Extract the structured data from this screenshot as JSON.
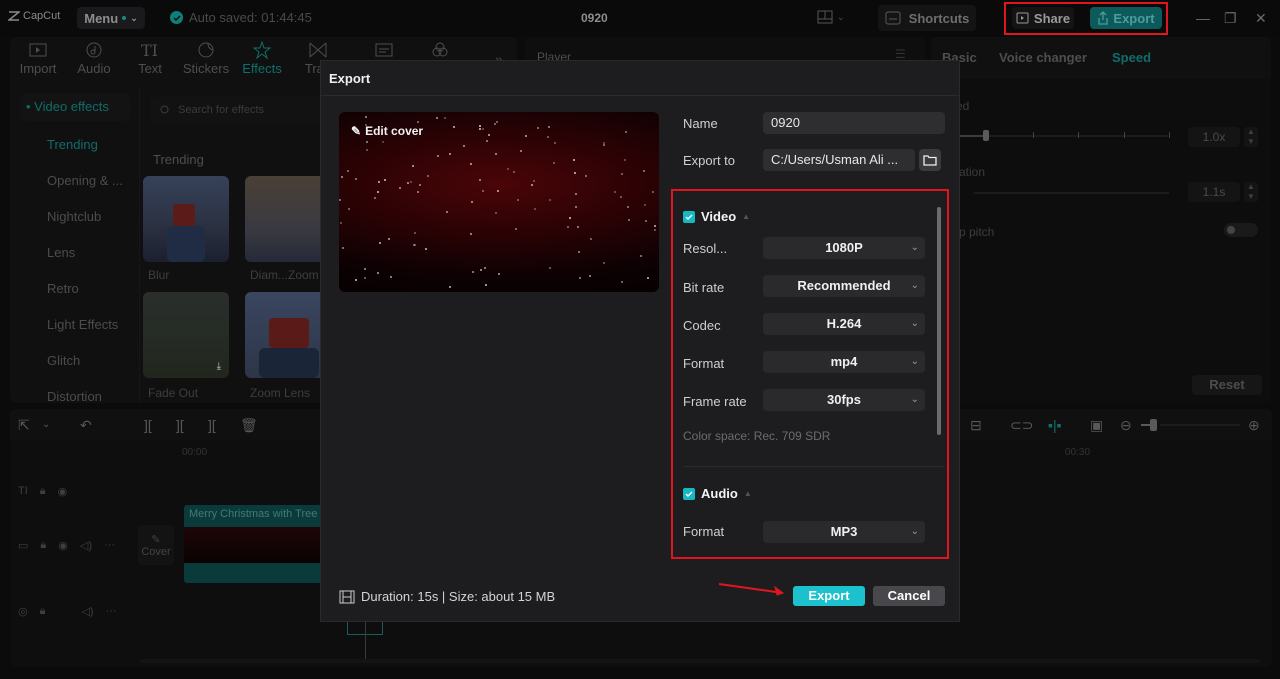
{
  "app": {
    "logo": "CapCut",
    "menu_label": "Menu",
    "autosave": "Auto saved: 01:44:45",
    "project_title": "0920",
    "shortcuts_label": "Shortcuts",
    "share_label": "Share",
    "export_label": "Export"
  },
  "tools": [
    {
      "label": "Import",
      "icon": "import-icon"
    },
    {
      "label": "Audio",
      "icon": "audio-icon"
    },
    {
      "label": "Text",
      "icon": "text-icon"
    },
    {
      "label": "Stickers",
      "icon": "stickers-icon"
    },
    {
      "label": "Effects",
      "icon": "effects-icon",
      "active": true
    },
    {
      "label": "Tran",
      "icon": "transitions-icon"
    }
  ],
  "effects_panel": {
    "section": "Video effects",
    "categories": [
      "Trending",
      "Opening & ...",
      "Nightclub",
      "Lens",
      "Retro",
      "Light Effects",
      "Glitch",
      "Distortion"
    ],
    "active_category": "Trending",
    "search_placeholder": "Search for effects",
    "heading": "Trending",
    "items": [
      "Blur",
      "Diam...Zoom",
      "Fade Out",
      "Zoom Lens"
    ]
  },
  "player": {
    "title": "Player"
  },
  "right_panel": {
    "tabs": [
      "Basic",
      "Voice changer",
      "Speed"
    ],
    "active_tab": "Speed",
    "speed_label": "ed",
    "speed_value": "1.0x",
    "duration_label": "ation",
    "duration_value": "1.1s",
    "pitch_label": "p pitch",
    "reset_label": "Reset"
  },
  "timeline": {
    "timecode_start": "00:00",
    "timecode_mid": "00:30",
    "cover_label": "Cover",
    "clip_title": "Merry Christmas with Tree"
  },
  "export_dialog": {
    "title": "Export",
    "edit_cover_label": "Edit cover",
    "name_label": "Name",
    "name_value": "0920",
    "export_to_label": "Export to",
    "export_to_value": "C:/Users/Usman Ali ...",
    "video": {
      "heading": "Video",
      "checked": true,
      "fields": [
        {
          "label": "Resol...",
          "value": "1080P"
        },
        {
          "label": "Bit rate",
          "value": "Recommended"
        },
        {
          "label": "Codec",
          "value": "H.264"
        },
        {
          "label": "Format",
          "value": "mp4"
        },
        {
          "label": "Frame rate",
          "value": "30fps"
        }
      ],
      "color_space": "Color space: Rec. 709 SDR"
    },
    "audio": {
      "heading": "Audio",
      "checked": true,
      "fields": [
        {
          "label": "Format",
          "value": "MP3"
        }
      ]
    },
    "footer_info": "Duration: 15s | Size: about 15 MB",
    "export_button": "Export",
    "cancel_button": "Cancel"
  },
  "colors": {
    "accent": "#1bc1cc",
    "highlight": "#e0161f"
  }
}
